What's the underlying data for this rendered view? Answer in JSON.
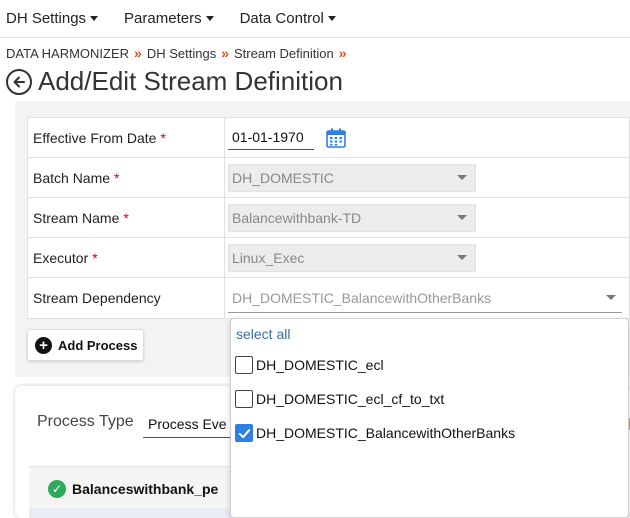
{
  "topnav": {
    "items": [
      {
        "label": "DH Settings"
      },
      {
        "label": "Parameters"
      },
      {
        "label": "Data Control"
      }
    ]
  },
  "breadcrumb": {
    "items": [
      "DATA HARMONIZER",
      "DH Settings",
      "Stream Definition"
    ],
    "separator": "»"
  },
  "page": {
    "title": "Add/Edit Stream Definition"
  },
  "form": {
    "required_mark": "*",
    "effective_from": {
      "label": "Effective From Date",
      "value": "01-01-1970"
    },
    "batch_name": {
      "label": "Batch Name",
      "value": "DH_DOMESTIC"
    },
    "stream_name": {
      "label": "Stream Name",
      "value": "Balancewithbank-TD"
    },
    "executor": {
      "label": "Executor",
      "value": "Linux_Exec"
    },
    "stream_dependency": {
      "label": "Stream Dependency",
      "value": "DH_DOMESTIC_BalancewithOtherBanks"
    }
  },
  "add_process": {
    "label": "Add Process"
  },
  "process": {
    "type_label": "Process Type",
    "type_value": "Process Eve",
    "header_title": "Balanceswithbank_pe"
  },
  "dropdown": {
    "select_all": "select all",
    "options": [
      {
        "label": "DH_DOMESTIC_ecl",
        "checked": false
      },
      {
        "label": "DH_DOMESTIC_ecl_cf_to_txt",
        "checked": false
      },
      {
        "label": "DH_DOMESTIC_BalancewithOtherBanks",
        "checked": true
      }
    ]
  },
  "colors": {
    "accent_separator": "#d9531e",
    "required": "#d0021b",
    "link": "#3a6ea5",
    "checkbox_checked": "#2f7fe0",
    "success": "#2eaa5a"
  }
}
